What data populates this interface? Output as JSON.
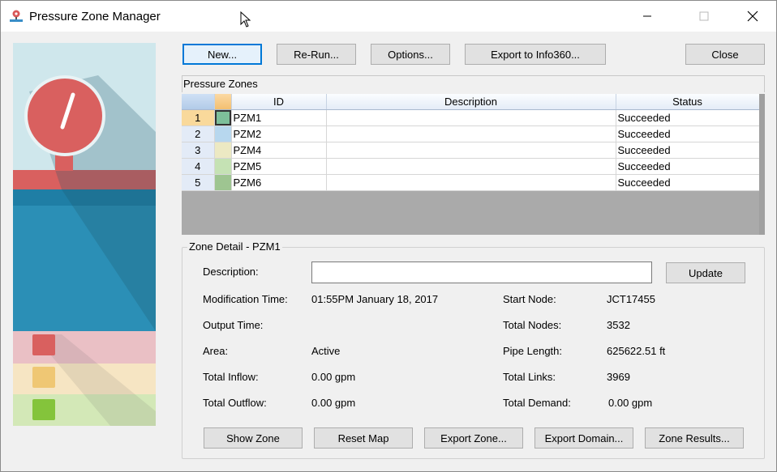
{
  "window": {
    "title": "Pressure Zone Manager",
    "controls": {
      "minimize": "minimize",
      "maximize": "maximize",
      "close": "close"
    }
  },
  "toolbar": {
    "new_label": "New...",
    "rerun_label": "Re-Run...",
    "options_label": "Options...",
    "export_info360_label": "Export to Info360...",
    "close_label": "Close"
  },
  "pressure_zones": {
    "group_title": "Pressure Zones",
    "columns": {
      "id": "ID",
      "description": "Description",
      "status": "Status"
    },
    "rows": [
      {
        "num": "1",
        "color": "#7dbf9a",
        "id": "PZM1",
        "description": "",
        "status": "Succeeded"
      },
      {
        "num": "2",
        "color": "#b7d7ee",
        "id": "PZM2",
        "description": "",
        "status": "Succeeded"
      },
      {
        "num": "3",
        "color": "#ece9c3",
        "id": "PZM4",
        "description": "",
        "status": "Succeeded"
      },
      {
        "num": "4",
        "color": "#c5e2b4",
        "id": "PZM5",
        "description": "",
        "status": "Succeeded"
      },
      {
        "num": "5",
        "color": "#9ec591",
        "id": "PZM6",
        "description": "",
        "status": "Succeeded"
      }
    ]
  },
  "zone_detail": {
    "title": "Zone Detail - PZM1",
    "description_label": "Description:",
    "description_value": "",
    "update_label": "Update",
    "modification_time_label": "Modification Time:",
    "modification_time_value": "01:55PM January 18, 2017",
    "output_time_label": "Output Time:",
    "output_time_value": "",
    "area_label": "Area:",
    "area_value": "Active",
    "total_inflow_label": "Total Inflow:",
    "total_inflow_value": "0.00 gpm",
    "total_outflow_label": "Total Outflow:",
    "total_outflow_value": "0.00 gpm",
    "start_node_label": "Start Node:",
    "start_node_value": "JCT17455",
    "total_nodes_label": "Total Nodes:",
    "total_nodes_value": "3532",
    "pipe_length_label": "Pipe Length:",
    "pipe_length_value": "625622.51 ft",
    "total_links_label": "Total Links:",
    "total_links_value": "3969",
    "total_demand_label": "Total Demand:",
    "total_demand_value": "0.00 gpm"
  },
  "bottom_buttons": {
    "show_zone": "Show Zone",
    "reset_map": "Reset Map",
    "export_zone": "Export Zone...",
    "export_domain": "Export Domain...",
    "zone_results": "Zone Results..."
  },
  "icons": {
    "app_icon": "pressure-pin-icon",
    "illustration": "pressure-gauge-illustration"
  }
}
